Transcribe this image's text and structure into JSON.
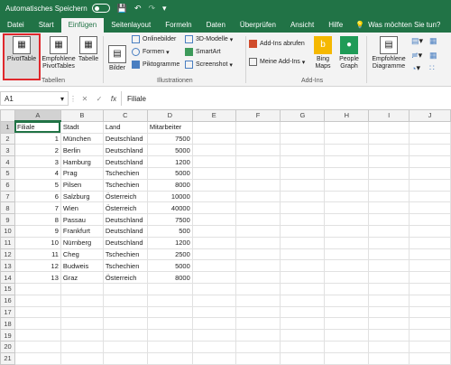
{
  "titlebar": {
    "autosave_label": "Automatisches Speichern",
    "toggle_state": "off"
  },
  "tabs": [
    "Datei",
    "Start",
    "Einfügen",
    "Seitenlayout",
    "Formeln",
    "Daten",
    "Überprüfen",
    "Ansicht",
    "Hilfe"
  ],
  "active_tab": "Einfügen",
  "search_label": "Was möchten Sie tun?",
  "ribbon": {
    "tables": {
      "pivot": "PivotTable",
      "recommended": "Empfohlene PivotTables",
      "table": "Tabelle",
      "group": "Tabellen"
    },
    "illustrations": {
      "pictures": "Bilder",
      "online_pictures": "Onlinebilder",
      "shapes": "Formen",
      "icons": "Piktogramme",
      "models3d": "3D-Modelle",
      "smartart": "SmartArt",
      "screenshot": "Screenshot",
      "group": "Illustrationen"
    },
    "addins": {
      "get_addins": "Add-Ins abrufen",
      "my_addins": "Meine Add-Ins",
      "bing_maps": "Bing Maps",
      "people_graph": "People Graph",
      "group": "Add-Ins"
    },
    "charts": {
      "recommended_charts": "Empfohlene Diagramme"
    }
  },
  "formula_bar": {
    "name_box": "A1",
    "fx": "fx",
    "value": "Filiale"
  },
  "columns": [
    "A",
    "B",
    "C",
    "D",
    "E",
    "F",
    "G",
    "H",
    "I",
    "J"
  ],
  "rows": [
    [
      "Filiale",
      "Stadt",
      "Land",
      "Mitarbeiter"
    ],
    [
      "1",
      "München",
      "Deutschland",
      "7500"
    ],
    [
      "2",
      "Berlin",
      "Deutschland",
      "5000"
    ],
    [
      "3",
      "Hamburg",
      "Deutschland",
      "1200"
    ],
    [
      "4",
      "Prag",
      "Tschechien",
      "5000"
    ],
    [
      "5",
      "Pilsen",
      "Tschechien",
      "8000"
    ],
    [
      "6",
      "Salzburg",
      "Österreich",
      "10000"
    ],
    [
      "7",
      "Wien",
      "Österreich",
      "40000"
    ],
    [
      "8",
      "Passau",
      "Deutschland",
      "7500"
    ],
    [
      "9",
      "Frankfurt",
      "Deutschland",
      "500"
    ],
    [
      "10",
      "Nürnberg",
      "Deutschland",
      "1200"
    ],
    [
      "11",
      "Cheg",
      "Tschechien",
      "2500"
    ],
    [
      "12",
      "Budweis",
      "Tschechien",
      "5000"
    ],
    [
      "13",
      "Graz",
      "Österreich",
      "8000"
    ],
    [
      "",
      "",
      "",
      ""
    ],
    [
      "",
      "",
      "",
      ""
    ],
    [
      "",
      "",
      "",
      ""
    ],
    [
      "",
      "",
      "",
      ""
    ],
    [
      "",
      "",
      "",
      ""
    ],
    [
      "",
      "",
      "",
      ""
    ],
    [
      "",
      "",
      "",
      ""
    ]
  ],
  "colors": {
    "accent": "#217346",
    "highlight": "#e0282c"
  }
}
